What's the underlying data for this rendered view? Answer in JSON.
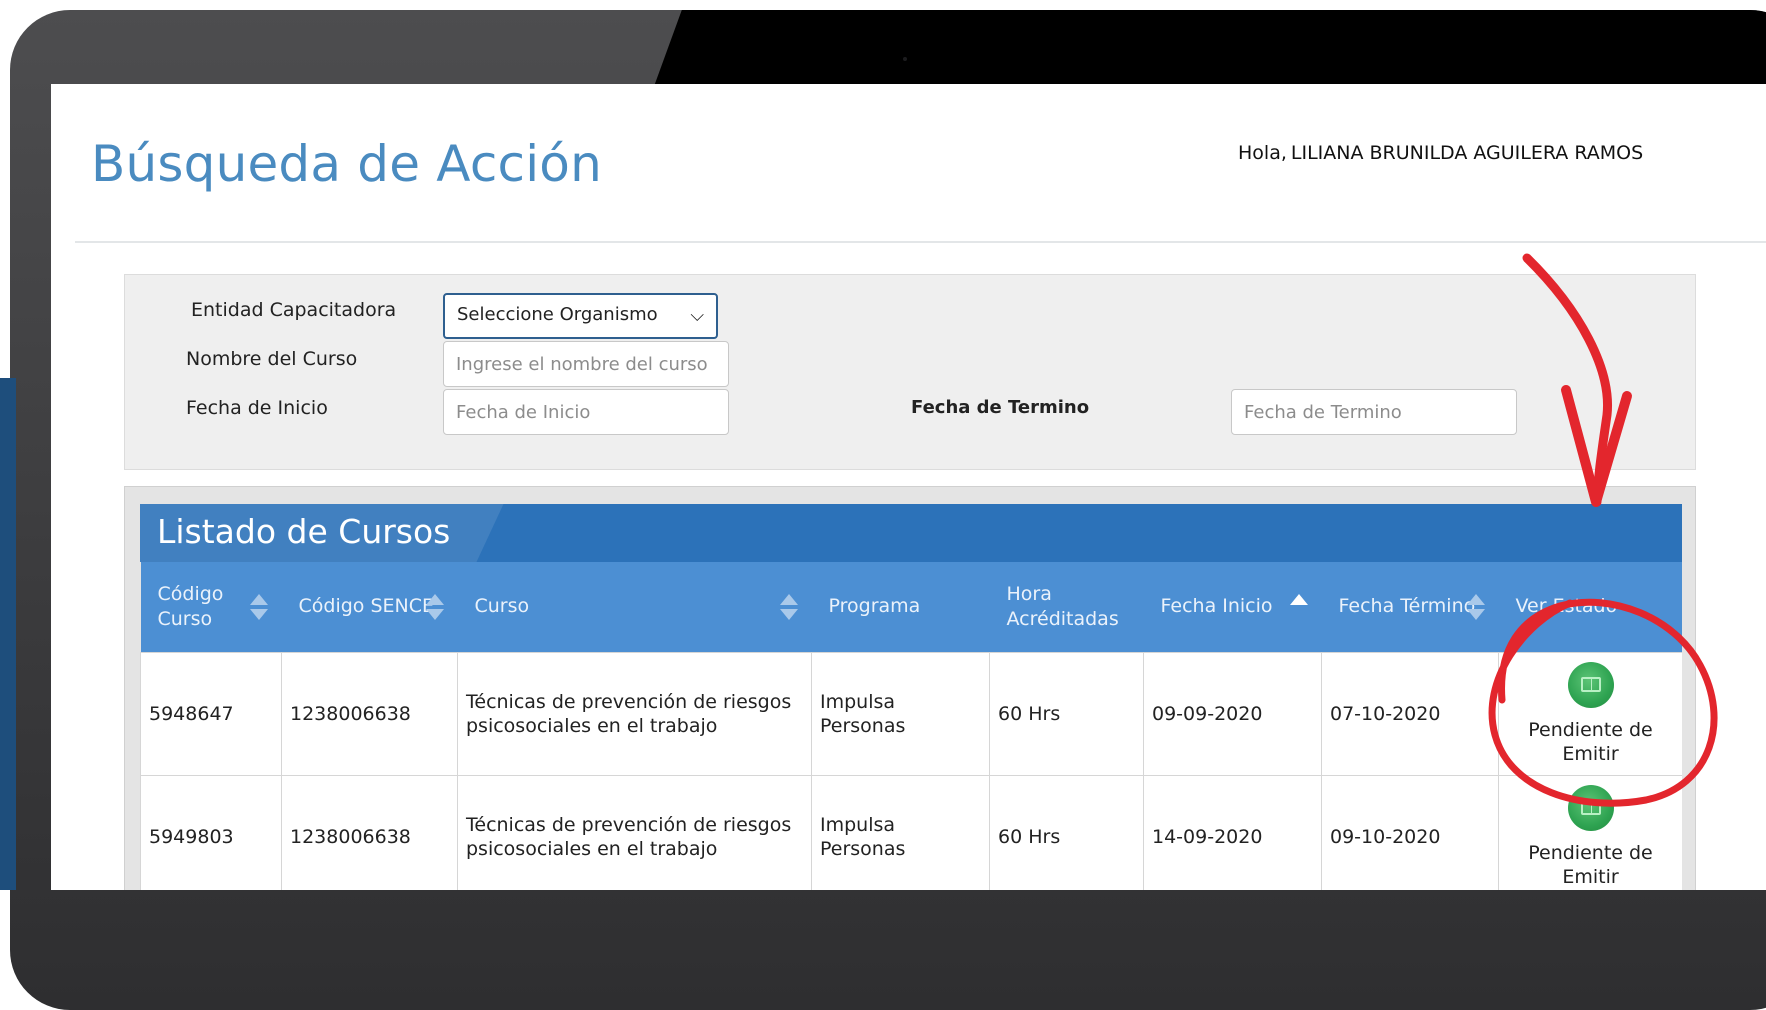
{
  "page": {
    "title": "Búsqueda de Acción",
    "greeting_prefix": "Hola,",
    "user_name": "LILIANA BRUNILDA AGUILERA RAMOS"
  },
  "filters": {
    "entidad_label": "Entidad Capacitadora",
    "entidad_value": "Seleccione Organismo",
    "curso_label": "Nombre del Curso",
    "curso_placeholder": "Ingrese el nombre del curso",
    "inicio_label": "Fecha de Inicio",
    "inicio_placeholder": "Fecha de Inicio",
    "termino_label": "Fecha de Termino",
    "termino_placeholder": "Fecha de Termino"
  },
  "table": {
    "title": "Listado de Cursos",
    "headers": {
      "codigo_curso": "Código Curso",
      "codigo_sence": "Código SENCE",
      "curso": "Curso",
      "programa": "Programa",
      "horas": "Hora Acréditadas",
      "fecha_inicio": "Fecha Inicio",
      "fecha_termino": "Fecha Término",
      "ver_estado": "Ver Estado"
    },
    "rows": [
      {
        "codigo_curso": "5948647",
        "codigo_sence": "1238006638",
        "curso": "Técnicas de prevención de riesgos psicosociales en el trabajo",
        "programa": "Impulsa Personas",
        "horas": "60 Hrs",
        "fecha_inicio": "09-09-2020",
        "fecha_termino": "07-10-2020",
        "estado": "Pendiente de Emitir"
      },
      {
        "codigo_curso": "5949803",
        "codigo_sence": "1238006638",
        "curso": "Técnicas de prevención de riesgos psicosociales en el trabajo",
        "programa": "Impulsa Personas",
        "horas": "60 Hrs",
        "fecha_inicio": "14-09-2020",
        "fecha_termino": "09-10-2020",
        "estado": "Pendiente de Emitir"
      }
    ]
  },
  "icons": {
    "status": "book-icon",
    "dropdown": "chevron-down-icon",
    "sort": "sort-icon"
  },
  "colors": {
    "title_blue": "#4a8bc0",
    "table_titlebar": "#2c72b9",
    "table_header": "#4c8fd3",
    "status_green": "#2ea351",
    "annotation_red": "#e3262d",
    "frame_dark": "#3a3a3c"
  }
}
